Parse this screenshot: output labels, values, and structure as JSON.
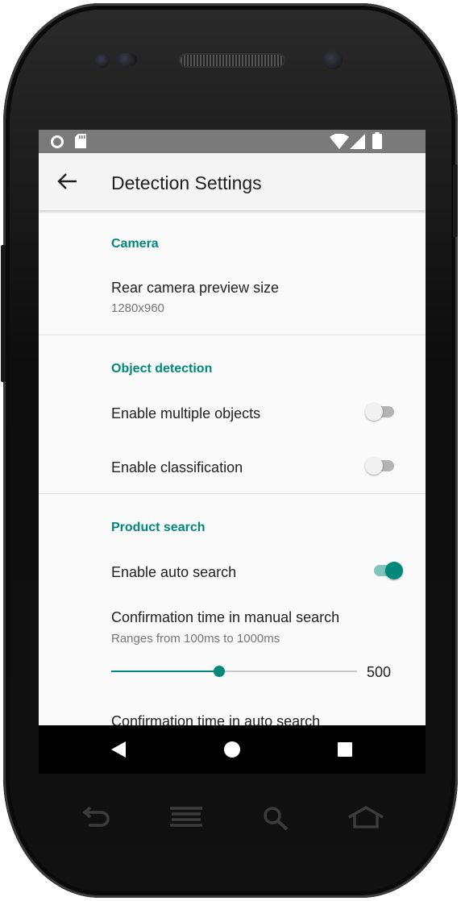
{
  "colors": {
    "accent": "#00897b",
    "statusbar": "#7a7a7a",
    "navbar": "#000000"
  },
  "status_bar": {
    "left_icons": [
      "circle-notification-icon",
      "sd-card-icon"
    ],
    "right_icons": [
      "wifi-icon",
      "cell-signal-icon",
      "battery-icon"
    ]
  },
  "app_bar": {
    "title": "Detection Settings",
    "nav_icon": "back-arrow-icon"
  },
  "sections": [
    {
      "category": "Camera",
      "items": [
        {
          "title": "Rear camera preview size",
          "summary": "1280x960"
        }
      ]
    },
    {
      "category": "Object detection",
      "items": [
        {
          "title": "Enable multiple objects",
          "switch_on": false
        },
        {
          "title": "Enable classification",
          "switch_on": false
        }
      ]
    },
    {
      "category": "Product search",
      "items": [
        {
          "title": "Enable auto search",
          "switch_on": true
        },
        {
          "title": "Confirmation time in manual search",
          "summary": "Ranges from 100ms to 1000ms",
          "slider_value": "500",
          "slider_fraction": 0.44
        },
        {
          "title": "Confirmation time in auto search"
        }
      ]
    }
  ],
  "nav_bar": {
    "icons": [
      "back-triangle-icon",
      "home-circle-icon",
      "recents-square-icon"
    ]
  },
  "hardware_keys": [
    "hw-back-icon",
    "hw-menu-icon",
    "hw-search-icon",
    "hw-home-icon"
  ]
}
